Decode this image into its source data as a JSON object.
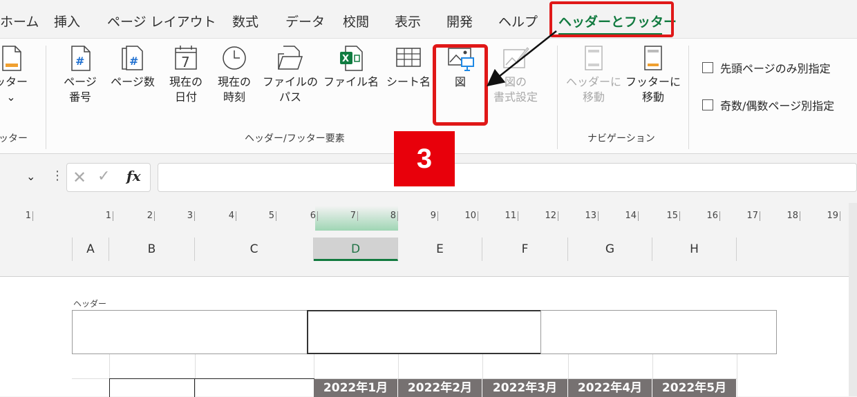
{
  "tabs": [
    {
      "label": "ホーム"
    },
    {
      "label": "挿入"
    },
    {
      "label": "ページ レイアウト"
    },
    {
      "label": "数式"
    },
    {
      "label": "データ"
    },
    {
      "label": "校閲"
    },
    {
      "label": "表示"
    },
    {
      "label": "開発"
    },
    {
      "label": "ヘルプ"
    },
    {
      "label": "ヘッダーとフッター"
    }
  ],
  "ribbon": {
    "footer_btn": {
      "line1": "ッター",
      "line2": "⌄"
    },
    "footer_group_label": "ッター",
    "elements": {
      "page_number": {
        "line1": "ページ",
        "line2": "番号"
      },
      "page_count": {
        "line1": "ページ数",
        "line2": ""
      },
      "current_date": {
        "line1": "現在の",
        "line2": "日付"
      },
      "current_time": {
        "line1": "現在の",
        "line2": "時刻"
      },
      "file_path": {
        "line1": "ファイルの",
        "line2": "パス"
      },
      "file_name": {
        "line1": "ファイル名",
        "line2": ""
      },
      "sheet_name": {
        "line1": "シート名",
        "line2": ""
      },
      "picture": {
        "line1": "図",
        "line2": ""
      },
      "format_picture": {
        "line1": "図の",
        "line2": "書式設定"
      }
    },
    "elements_group_label": "ヘッダー/フッター要素",
    "navigation": {
      "goto_header": {
        "line1": "ヘッダーに",
        "line2": "移動"
      },
      "goto_footer": {
        "line1": "フッターに",
        "line2": "移動"
      }
    },
    "navigation_group_label": "ナビゲーション",
    "options": {
      "different_first_page": "先頭ページのみ別指定",
      "different_odd_even": "奇数/偶数ページ別指定"
    }
  },
  "step_badge": "3",
  "formula_bar": {
    "fx": "fx",
    "value": ""
  },
  "ruler": [
    "1",
    "1",
    "2",
    "3",
    "4",
    "5",
    "6",
    "7",
    "8",
    "9",
    "10",
    "11",
    "12",
    "13",
    "14",
    "15",
    "16",
    "17",
    "18",
    "19"
  ],
  "columns": [
    "A",
    "B",
    "C",
    "D",
    "E",
    "F",
    "G",
    "H"
  ],
  "sheet": {
    "header_label": "ヘッダー",
    "month_headers": [
      "2022年1月",
      "2022年2月",
      "2022年3月",
      "2022年4月",
      "2022年5月"
    ]
  },
  "colors": {
    "accent": "#117a3f",
    "highlight": "#e01818",
    "badge": "#e8000b",
    "month_header_bg": "#767171"
  }
}
